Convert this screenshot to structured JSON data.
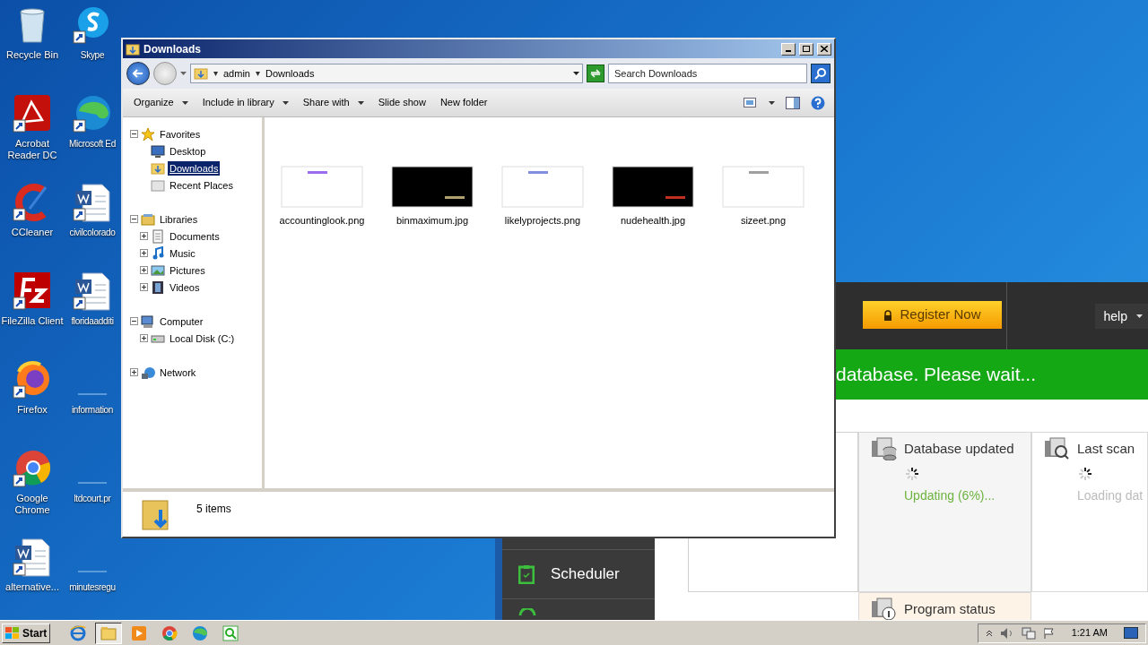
{
  "desktop_icons": [
    {
      "label": "Recycle Bin",
      "kind": "recycle"
    },
    {
      "label": "Skype",
      "kind": "skype"
    },
    {
      "label": "Acrobat Reader DC",
      "kind": "acrobat"
    },
    {
      "label": "Microsoft Ed",
      "kind": "edge"
    },
    {
      "label": "CCleaner",
      "kind": "ccleaner"
    },
    {
      "label": "civilcolorado",
      "kind": "word"
    },
    {
      "label": "FileZilla Client",
      "kind": "filezilla"
    },
    {
      "label": "floridaadditi",
      "kind": "word"
    },
    {
      "label": "Firefox",
      "kind": "firefox"
    },
    {
      "label": "information",
      "kind": "blank"
    },
    {
      "label": "Google Chrome",
      "kind": "chrome"
    },
    {
      "label": "ltdcourt.pr",
      "kind": "blank"
    },
    {
      "label": "alternative...",
      "kind": "word"
    },
    {
      "label": "minutesregu",
      "kind": "blank"
    }
  ],
  "app": {
    "register": "Register Now",
    "help": "help",
    "banner": "database. Please wait...",
    "sidebar": [
      {
        "label": "Scheduler"
      }
    ],
    "cards": [
      {
        "title": "Database updated",
        "status": "Updating (6%)...",
        "kind": "database",
        "busy": true
      },
      {
        "title": "Last scan",
        "status": "Loading dat",
        "kind": "scan",
        "busy": true
      },
      {
        "title": "Program status",
        "kind": "status"
      }
    ]
  },
  "explorer": {
    "title": "Downloads",
    "address": [
      "admin",
      "Downloads"
    ],
    "search_placeholder": "Search Downloads",
    "toolbar": [
      {
        "label": "Organize",
        "dropdown": true
      },
      {
        "label": "Include in library",
        "dropdown": true
      },
      {
        "label": "Share with",
        "dropdown": true
      },
      {
        "label": "Slide show",
        "dropdown": false
      },
      {
        "label": "New folder",
        "dropdown": false
      }
    ],
    "nav": [
      {
        "label": "Favorites",
        "kind": "star",
        "expanded": true,
        "selected": false,
        "children": [
          {
            "label": "Desktop",
            "kind": "desktop",
            "selected": false
          },
          {
            "label": "Downloads",
            "kind": "downloads",
            "selected": true
          },
          {
            "label": "Recent Places",
            "kind": "recent",
            "selected": false
          }
        ]
      },
      {
        "label": "Libraries",
        "kind": "library",
        "expanded": true,
        "selected": false,
        "children": [
          {
            "label": "Documents",
            "kind": "documents",
            "expanded": false,
            "selected": false
          },
          {
            "label": "Music",
            "kind": "music",
            "expanded": false,
            "selected": false
          },
          {
            "label": "Pictures",
            "kind": "pictures",
            "expanded": false,
            "selected": false
          },
          {
            "label": "Videos",
            "kind": "videos",
            "expanded": false,
            "selected": false
          }
        ]
      },
      {
        "label": "Computer",
        "kind": "computer",
        "expanded": true,
        "selected": false,
        "children": [
          {
            "label": "Local Disk (C:)",
            "kind": "disk",
            "expanded": false,
            "selected": false
          }
        ]
      },
      {
        "label": "Network",
        "kind": "network",
        "expanded": false,
        "selected": false
      }
    ],
    "files": [
      {
        "name": "accountinglook.png",
        "kind": "light",
        "color": "#9b6cf0"
      },
      {
        "name": "binmaximum.jpg",
        "kind": "dark",
        "color": "#b0a070"
      },
      {
        "name": "likelyprojects.png",
        "kind": "light",
        "color": "#8090e0"
      },
      {
        "name": "nudehealth.jpg",
        "kind": "dark",
        "color": "#c03020"
      },
      {
        "name": "sizeet.png",
        "kind": "light",
        "color": "#a0a0a0"
      }
    ],
    "status": "5 items"
  },
  "taskbar": {
    "start": "Start",
    "apps": [
      {
        "kind": "ie",
        "selected": false
      },
      {
        "kind": "folder",
        "selected": true
      },
      {
        "kind": "media",
        "selected": false
      },
      {
        "kind": "chrome",
        "selected": false
      },
      {
        "kind": "edge",
        "selected": false
      },
      {
        "kind": "app",
        "selected": false
      }
    ],
    "time": "1:21 AM"
  }
}
